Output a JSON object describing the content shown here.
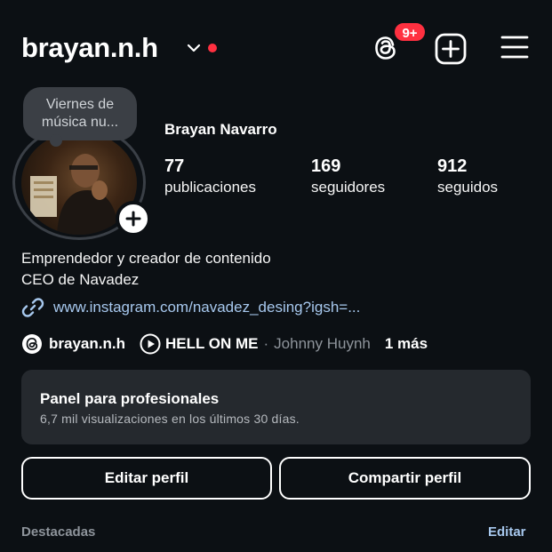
{
  "header": {
    "username": "brayan.n.h",
    "threads_badge": "9+",
    "icons": [
      "chevron-down-icon",
      "threads-icon",
      "add-post-icon",
      "hamburger-menu-icon"
    ]
  },
  "profile": {
    "note": "Viernes de música nu...",
    "full_name": "Brayan Navarro",
    "stats": [
      {
        "value": "77",
        "label": "publicaciones"
      },
      {
        "value": "169",
        "label": "seguidores"
      },
      {
        "value": "912",
        "label": "seguidos"
      }
    ],
    "bio": [
      "Emprendedor y creador de contenido",
      "CEO de Navadez"
    ],
    "link": "www.instagram.com/navadez_desing?igsh=...",
    "threads_username": "brayan.n.h",
    "song": "HELL ON ME",
    "separator": "·",
    "artist": "Johnny Huynh",
    "more": "1 más"
  },
  "panel": {
    "title": "Panel para profesionales",
    "subtitle": "6,7 mil visualizaciones en los últimos 30 días."
  },
  "buttons": {
    "edit": "Editar perfil",
    "share": "Compartir perfil"
  },
  "highlights": {
    "title": "Destacadas",
    "edit": "Editar"
  },
  "colors": {
    "background": "#0c1014",
    "badge": "#ff3040",
    "link": "#a7c8ee",
    "panel": "#25292e"
  }
}
